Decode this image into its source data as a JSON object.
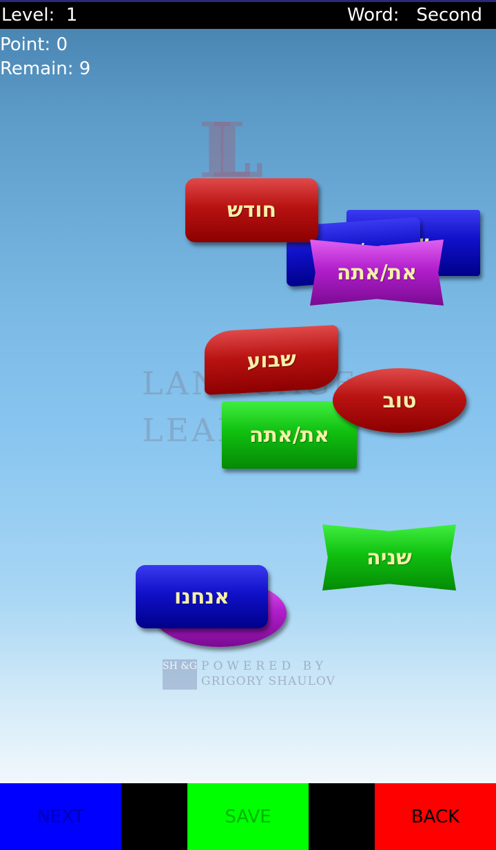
{
  "header": {
    "level_label": "Level:",
    "level_value": "1",
    "word_label": "Word:",
    "word_value": "Second"
  },
  "stats": {
    "point_label": "Point:",
    "point_value": "0",
    "remain_label": "Remain:",
    "remain_value": "9"
  },
  "watermark": {
    "letter": "LL",
    "line1": "LANGUAGE",
    "line2": "LEARNING",
    "powered": "POWERED BY",
    "author": "GRIGORY SHAULOV",
    "logo": "SH &G"
  },
  "tiles": [
    {
      "text": "חודש",
      "color": "red",
      "shape": "rounded-rect"
    },
    {
      "text": "שני",
      "color": "blue",
      "shape": "rect"
    },
    {
      "text": "את/אתה",
      "color": "blue",
      "shape": "wave"
    },
    {
      "text": "את/אתה",
      "color": "purple",
      "shape": "pinched"
    },
    {
      "text": "שבוע",
      "color": "red",
      "shape": "wave"
    },
    {
      "text": "טוב",
      "color": "red",
      "shape": "ellipse"
    },
    {
      "text": "את/אתה",
      "color": "green",
      "shape": "rect"
    },
    {
      "text": "שניה",
      "color": "green",
      "shape": "pinched"
    },
    {
      "text": "",
      "color": "purple",
      "shape": "ellipse"
    },
    {
      "text": "אנחנו",
      "color": "blue",
      "shape": "rounded-rect"
    }
  ],
  "buttons": {
    "next": "NEXT",
    "save": "SAVE",
    "back": "BACK"
  },
  "colors": {
    "next": "#0000ff",
    "save": "#00ff00",
    "back": "#ff0000",
    "bar": "#000000"
  }
}
